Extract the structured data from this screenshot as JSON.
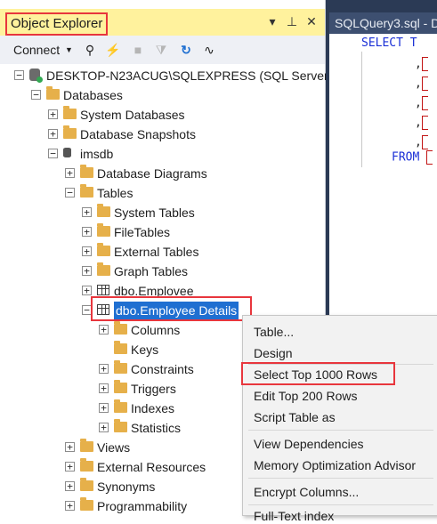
{
  "object_explorer": {
    "title": "Object Explorer",
    "toolbar": {
      "connect_label": "Connect"
    },
    "tree": [
      {
        "label": "DESKTOP-N23ACUG\\SQLEXPRESS (SQL Server",
        "icon": "server-icon",
        "expander": "−"
      },
      {
        "label": "Databases",
        "icon": "folder-icon",
        "expander": "−"
      },
      {
        "label": "System Databases",
        "icon": "folder-icon",
        "expander": "+"
      },
      {
        "label": "Database Snapshots",
        "icon": "folder-icon",
        "expander": "+"
      },
      {
        "label": "imsdb",
        "icon": "database-icon",
        "expander": "−"
      },
      {
        "label": "Database Diagrams",
        "icon": "folder-icon",
        "expander": "+"
      },
      {
        "label": "Tables",
        "icon": "folder-icon",
        "expander": "−"
      },
      {
        "label": "System Tables",
        "icon": "folder-icon",
        "expander": "+"
      },
      {
        "label": "FileTables",
        "icon": "folder-icon",
        "expander": "+"
      },
      {
        "label": "External Tables",
        "icon": "folder-icon",
        "expander": "+"
      },
      {
        "label": "Graph Tables",
        "icon": "folder-icon",
        "expander": "+"
      },
      {
        "label": "dbo.Emplovee",
        "icon": "table-icon",
        "expander": "+"
      },
      {
        "label": "dbo.Employee Details",
        "icon": "table-icon",
        "expander": "−"
      },
      {
        "label": "Columns",
        "icon": "folder-icon",
        "expander": "+"
      },
      {
        "label": "Keys",
        "icon": "folder-icon",
        "expander": ""
      },
      {
        "label": "Constraints",
        "icon": "folder-icon",
        "expander": "+"
      },
      {
        "label": "Triggers",
        "icon": "folder-icon",
        "expander": "+"
      },
      {
        "label": "Indexes",
        "icon": "folder-icon",
        "expander": "+"
      },
      {
        "label": "Statistics",
        "icon": "folder-icon",
        "expander": "+"
      },
      {
        "label": "Views",
        "icon": "folder-icon",
        "expander": "+"
      },
      {
        "label": "External Resources",
        "icon": "folder-icon",
        "expander": "+"
      },
      {
        "label": "Synonyms",
        "icon": "folder-icon",
        "expander": "+"
      },
      {
        "label": "Programmability",
        "icon": "folder-icon",
        "expander": "+"
      }
    ]
  },
  "editor": {
    "tab_title": "SQLQuery3.sql - D",
    "select_kw": "SELECT",
    "select_rest": "T",
    "from_kw": "FROM",
    "comma": ","
  },
  "context_menu": {
    "items": [
      "Table...",
      "Design",
      "Select Top 1000 Rows",
      "Edit Top 200 Rows",
      "Script Table as",
      "View Dependencies",
      "Memory Optimization Advisor",
      "Encrypt Columns...",
      "Full-Text index"
    ],
    "highlighted_item": "Select Top 1000 Rows"
  },
  "colors": {
    "title_bar": "#fff29d",
    "annotation_red": "#e8363d",
    "selection_blue": "#1f6fd1",
    "editor_bg": "#2b3a55",
    "keyword_blue": "#1a2fd6"
  }
}
